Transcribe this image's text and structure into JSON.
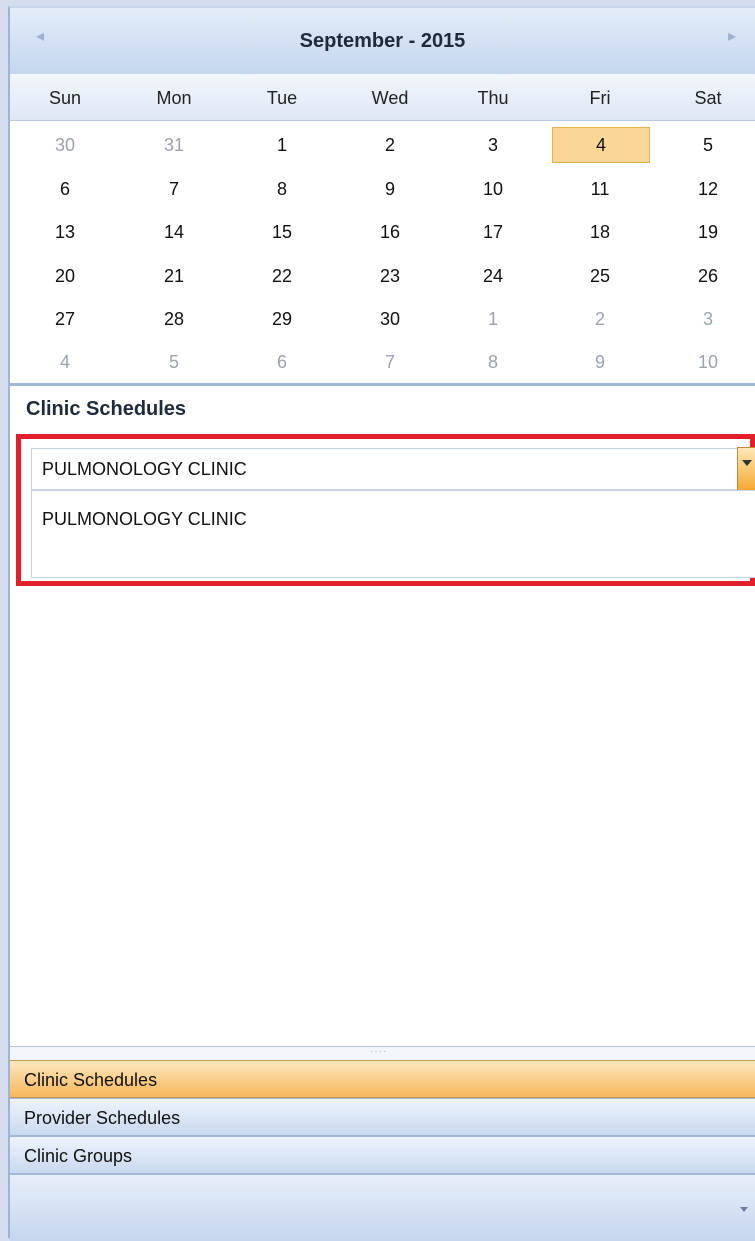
{
  "calendar": {
    "title": "September - 2015",
    "prev_arrow": "◂",
    "next_arrow": "▸",
    "days_of_week": [
      "Sun",
      "Mon",
      "Tue",
      "Wed",
      "Thu",
      "Fri",
      "Sat"
    ],
    "weeks": [
      [
        "30",
        "31",
        "1",
        "2",
        "3",
        "4",
        "5"
      ],
      [
        "6",
        "7",
        "8",
        "9",
        "10",
        "11",
        "12"
      ],
      [
        "13",
        "14",
        "15",
        "16",
        "17",
        "18",
        "19"
      ],
      [
        "20",
        "21",
        "22",
        "23",
        "24",
        "25",
        "26"
      ],
      [
        "27",
        "28",
        "29",
        "30",
        "1",
        "2",
        "3"
      ],
      [
        "4",
        "5",
        "6",
        "7",
        "8",
        "9",
        "10"
      ]
    ],
    "other_month_cells": [
      [
        0,
        0
      ],
      [
        0,
        1
      ],
      [
        4,
        4
      ],
      [
        4,
        5
      ],
      [
        4,
        6
      ],
      [
        5,
        0
      ],
      [
        5,
        1
      ],
      [
        5,
        2
      ],
      [
        5,
        3
      ],
      [
        5,
        4
      ],
      [
        5,
        5
      ],
      [
        5,
        6
      ]
    ],
    "today_cell": [
      0,
      5
    ],
    "today_color": "#fbd797"
  },
  "clinic_schedules": {
    "title": "Clinic Schedules",
    "combo_value": "PULMONOLOGY CLINIC",
    "dropdown_options": [
      "PULMONOLOGY CLINIC"
    ],
    "highlight_color": "#e2202c"
  },
  "splitter": {
    "grip": "····"
  },
  "nav_panes": [
    {
      "label": "Clinic Schedules",
      "selected": true
    },
    {
      "label": "Provider Schedules",
      "selected": false
    },
    {
      "label": "Clinic Groups",
      "selected": false
    }
  ],
  "footer": {
    "menu_icon": "chevron-down-icon"
  }
}
